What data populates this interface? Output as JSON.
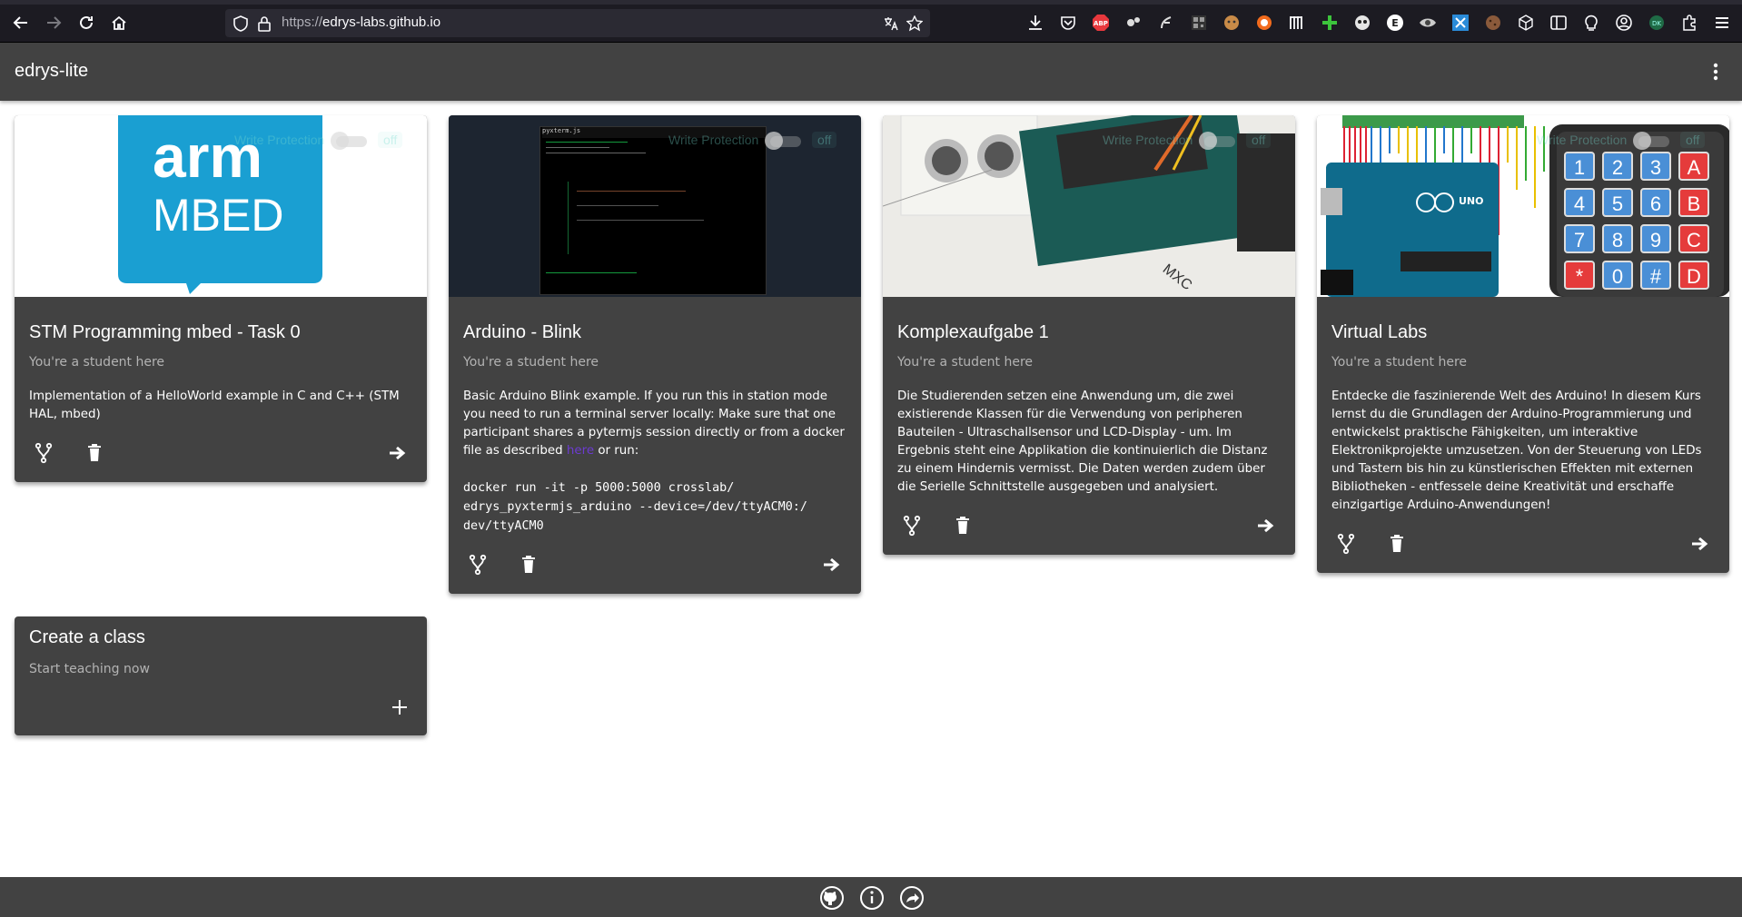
{
  "browser": {
    "url_scheme": "https://",
    "url_host": "edrys-labs.github.io"
  },
  "appbar": {
    "title": "edrys-lite"
  },
  "write_protection": {
    "label": "Write Protection",
    "state": "off"
  },
  "cards": [
    {
      "title": "STM Programming mbed - Task 0",
      "subtitle": "You're a student here",
      "description": "Implementation of a HelloWorld example in C and C++ (STM HAL, mbed)",
      "media_text_1": "arm",
      "media_text_2": "MBED"
    },
    {
      "title": "Arduino - Blink",
      "subtitle": "You're a student here",
      "description_1": "Basic Arduino Blink example. If you run this in station mode you need to run a terminal server locally: Make sure that one participant shares a pytermjs session directly or from a docker file as described ",
      "link_text": "here",
      "description_2": " or run:",
      "code": "docker run -it -p 5000:5000 crosslab/ edrys_pyxtermjs_arduino --device=/dev/ttyACM0:/ dev/ttyACM0",
      "media_text": "pyxterm.js"
    },
    {
      "title": "Komplexaufgabe 1",
      "subtitle": "You're a student here",
      "description": "Die Studierenden setzen eine Anwendung um, die zwei existierende Klassen für die Verwendung von peripheren Bauteilen - Ultraschallsensor und LCD-Display - um. Im Ergebnis steht eine Applikation die kontinuierlich die Distanz zu einem Hindernis vermisst. Die Daten werden zudem über die Serielle Schnittstelle ausgegeben und analysiert.",
      "media_text": "MXC"
    },
    {
      "title": "Virtual Labs",
      "subtitle": "You're a student here",
      "description": "Entdecke die faszinierende Welt des Arduino! In diesem Kurs lernst du die Grundlagen der Arduino-Programmierung und entwickelst praktische Fähigkeiten, um interaktive Elektronikprojekte umzusetzen. Von der Steuerung von LEDs und Tastern bis hin zu künstlerischen Effekten mit externen Bibliotheken - entfessele deine Kreativität und erschaffe einzigartige Arduino-Anwendungen!",
      "keypad": [
        "1",
        "2",
        "3",
        "A",
        "4",
        "5",
        "6",
        "B",
        "7",
        "8",
        "9",
        "C",
        "*",
        "0",
        "#",
        "D"
      ],
      "board_label": "UNO"
    }
  ],
  "create_card": {
    "title": "Create a class",
    "subtitle": "Start teaching now"
  },
  "colors": {
    "appbar": "#424242",
    "card": "#424242",
    "link": "#6c3bd1",
    "arm_blue": "#1a9fd2"
  }
}
